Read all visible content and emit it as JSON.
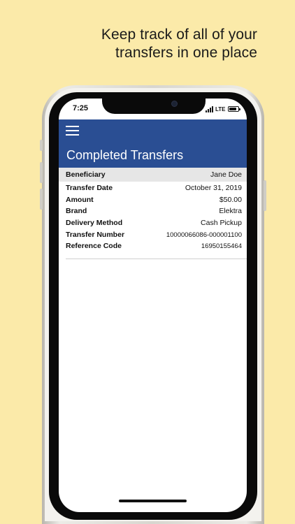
{
  "headline": {
    "line1": "Keep track of all of your",
    "line2": "transfers in one place"
  },
  "status_bar": {
    "time": "7:25",
    "network": "LTE",
    "signal_icon": "signal-bars-icon",
    "battery_icon": "battery-icon"
  },
  "header": {
    "menu_icon": "hamburger-menu-icon",
    "title": "Completed Transfers"
  },
  "beneficiary": {
    "label": "Beneficiary",
    "value": "Jane Doe"
  },
  "details": [
    {
      "label": "Transfer Date",
      "value": "October 31, 2019"
    },
    {
      "label": "Amount",
      "value": "$50.00"
    },
    {
      "label": "Brand",
      "value": "Elektra"
    },
    {
      "label": "Delivery Method",
      "value": "Cash Pickup"
    },
    {
      "label": "Transfer Number",
      "value": "10000066086-000001100"
    },
    {
      "label": "Reference Code",
      "value": "16950155464"
    }
  ],
  "colors": {
    "background": "#FBEAA9",
    "header": "#2A4E93",
    "beneficiary_bar": "#E6E6E6"
  }
}
